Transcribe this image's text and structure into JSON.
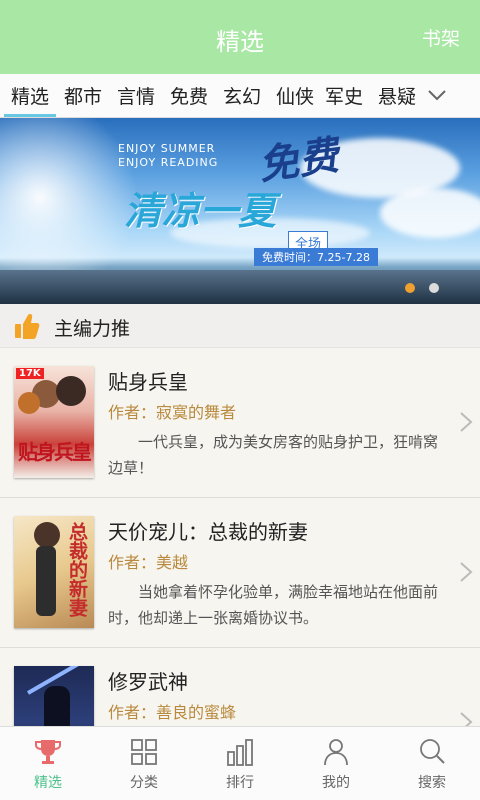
{
  "header": {
    "title": "精选",
    "shelf_label": "书架"
  },
  "categories": [
    "精选",
    "都市",
    "言情",
    "免费",
    "玄幻",
    "仙侠",
    "军史",
    "悬疑"
  ],
  "active_category": "精选",
  "banner": {
    "enjoy_line1": "ENJOY SUMMER",
    "enjoy_line2": "ENJOY READING",
    "free_text": "免费",
    "headline": "清凉一夏",
    "allsite": "全场",
    "free_time": "免费时间：7.25-7.28",
    "page_count": 2,
    "active_page": 1
  },
  "section": {
    "title": "主编力推"
  },
  "books": [
    {
      "title": "贴身兵皇",
      "author": "作者：寂寞的舞者",
      "desc": "一代兵皇，成为美女房客的贴身护卫，狂啃窝边草！",
      "cover_text": "贴身兵皇",
      "cover_tag": "17K"
    },
    {
      "title": "天价宠儿：总裁的新妻",
      "author": "作者：美越",
      "desc": "当她拿着怀孕化验单，满脸幸福地站在他面前时，他却递上一张离婚协议书。",
      "cover_text": "总裁的新妻"
    },
    {
      "title": "修罗武神",
      "author": "作者：善良的蜜蜂",
      "desc": "",
      "cover_text": ""
    }
  ],
  "tabs": [
    {
      "label": "精选",
      "icon": "trophy-icon"
    },
    {
      "label": "分类",
      "icon": "grid-icon"
    },
    {
      "label": "排行",
      "icon": "bar-chart-icon"
    },
    {
      "label": "我的",
      "icon": "user-icon"
    },
    {
      "label": "搜索",
      "icon": "search-icon"
    }
  ],
  "colors": {
    "header_bg": "#a9e8a4",
    "active_tab": "#4cc18a",
    "author": "#b98a3e",
    "underline": "#68c7e3"
  }
}
